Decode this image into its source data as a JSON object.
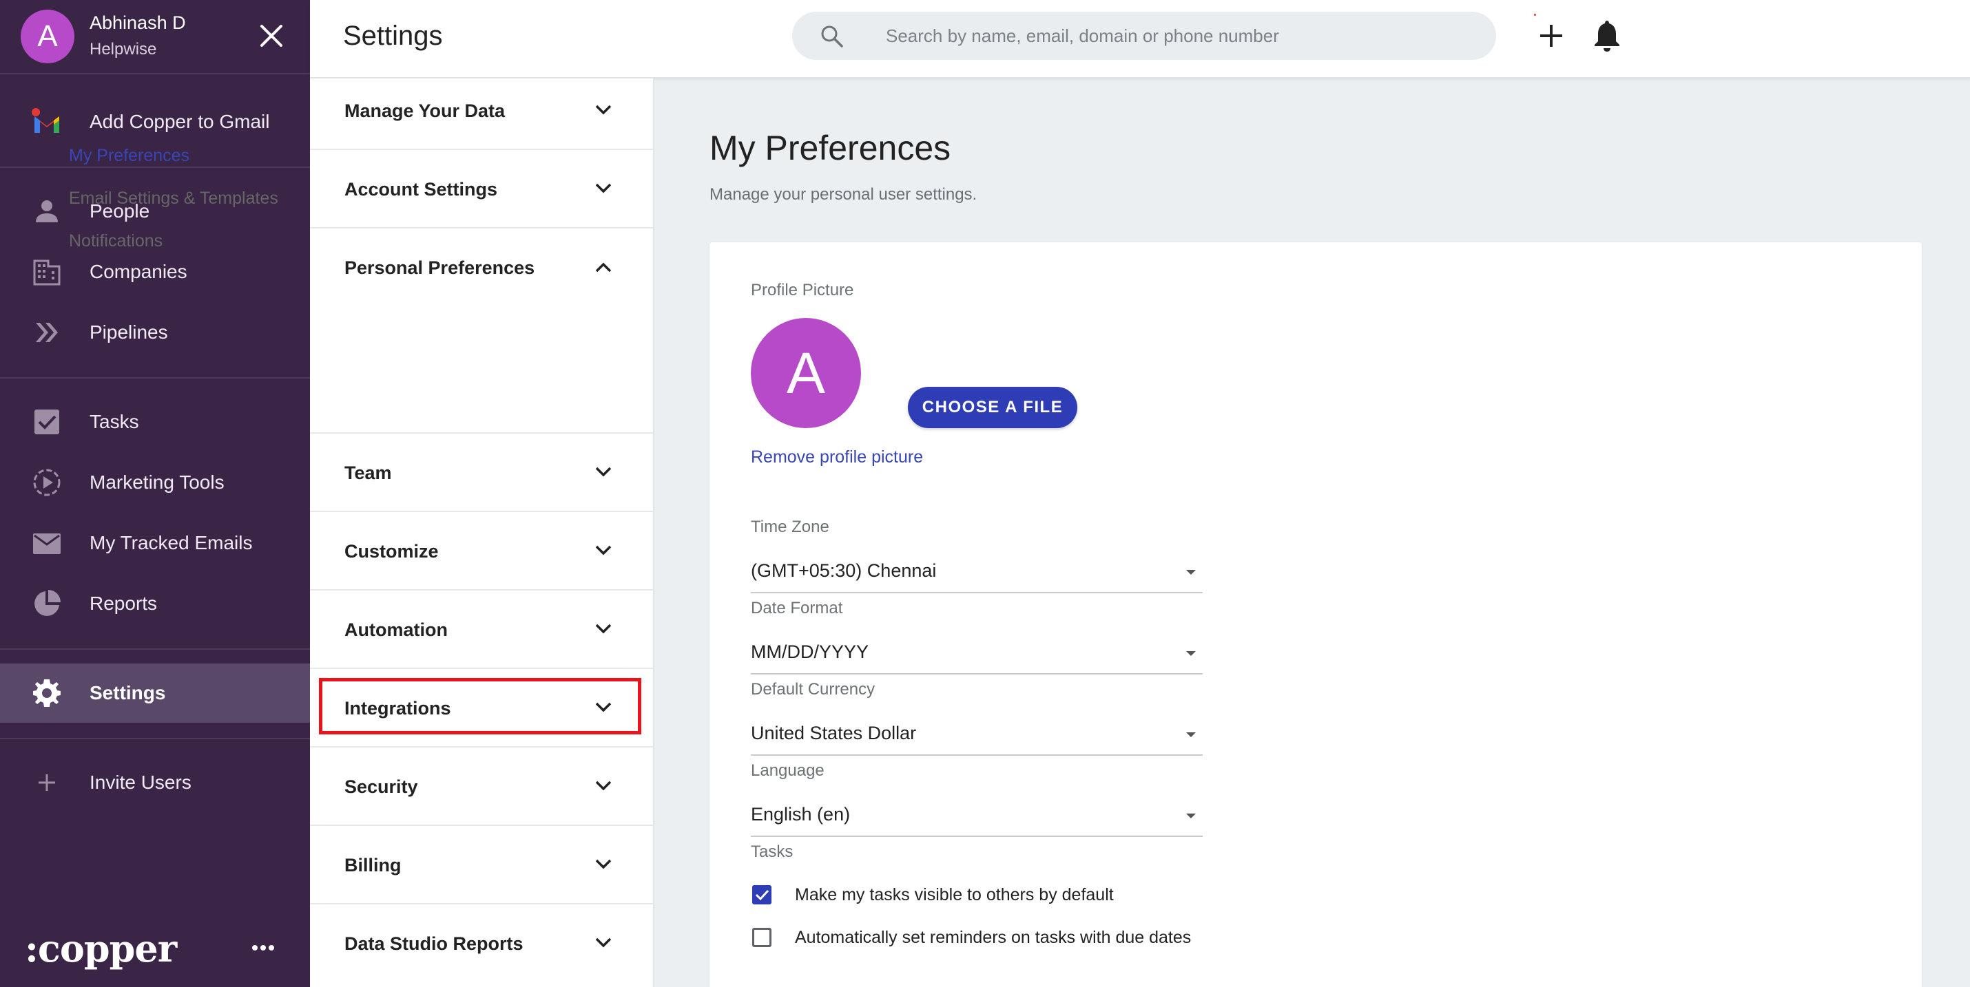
{
  "user": {
    "initial": "A",
    "name": "Abhinash D",
    "org": "Helpwise"
  },
  "leftnav": {
    "add_gmail": "Add Copper to Gmail",
    "items": [
      {
        "label": "People",
        "icon": "person-icon"
      },
      {
        "label": "Companies",
        "icon": "building-icon"
      },
      {
        "label": "Pipelines",
        "icon": "double-chevron-icon"
      },
      {
        "label": "Tasks",
        "icon": "checkbox-icon"
      },
      {
        "label": "Marketing Tools",
        "icon": "play-circle-icon"
      },
      {
        "label": "My Tracked Emails",
        "icon": "mail-icon"
      },
      {
        "label": "Reports",
        "icon": "pie-chart-icon"
      },
      {
        "label": "Settings",
        "icon": "gear-icon",
        "active": true
      },
      {
        "label": "Invite Users",
        "icon": "plus-icon"
      }
    ],
    "brand": ":copper"
  },
  "topbar": {
    "title": "Settings",
    "search_placeholder": "Search by name, email, domain or phone number"
  },
  "settings_menu": {
    "sections": [
      {
        "label": "Manage Your Data",
        "expanded": false
      },
      {
        "label": "Account Settings",
        "expanded": false
      },
      {
        "label": "Personal Preferences",
        "expanded": true,
        "children": [
          "My Preferences",
          "Email Settings & Templates",
          "Notifications"
        ],
        "active_child": "My Preferences"
      },
      {
        "label": "Team",
        "expanded": false
      },
      {
        "label": "Customize",
        "expanded": false
      },
      {
        "label": "Automation",
        "expanded": false
      },
      {
        "label": "Integrations",
        "expanded": false,
        "highlighted": true
      },
      {
        "label": "Security",
        "expanded": false
      },
      {
        "label": "Billing",
        "expanded": false
      },
      {
        "label": "Data Studio Reports",
        "expanded": false
      }
    ]
  },
  "main": {
    "title": "My Preferences",
    "subtitle": "Manage your personal user settings.",
    "profile_picture_label": "Profile Picture",
    "avatar_initial": "A",
    "choose_file": "CHOOSE A FILE",
    "remove_picture": "Remove profile picture",
    "fields": [
      {
        "label": "Time Zone",
        "value": "(GMT+05:30) Chennai"
      },
      {
        "label": "Date Format",
        "value": "MM/DD/YYYY"
      },
      {
        "label": "Default Currency",
        "value": "United States Dollar"
      },
      {
        "label": "Language",
        "value": "English (en)"
      }
    ],
    "tasks_label": "Tasks",
    "task_options": [
      {
        "label": "Make my tasks visible to others by default",
        "checked": true
      },
      {
        "label": "Automatically set reminders on tasks with due dates",
        "checked": false
      }
    ]
  },
  "colors": {
    "nav_bg": "#3b2546",
    "nav_active": "#5a4868",
    "accent": "#2e3db5",
    "avatar": "#b64ac8",
    "highlight": "#e8141c"
  }
}
